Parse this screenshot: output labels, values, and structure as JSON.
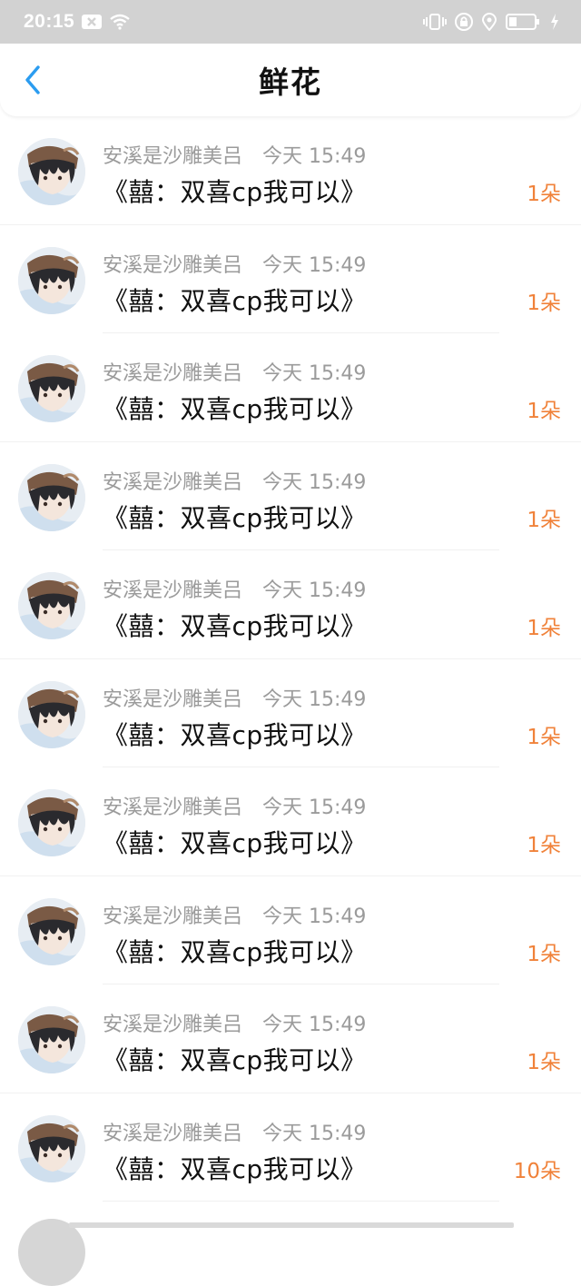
{
  "status_bar": {
    "time": "20:15",
    "icons": [
      "notification-x-icon",
      "wifi-icon",
      "vibrate-icon",
      "lock-icon",
      "location-icon",
      "battery-icon",
      "charging-icon"
    ]
  },
  "header": {
    "title": "鲜花",
    "back_icon": "chevron-left-icon"
  },
  "colors": {
    "accent_blue": "#2b9cf0",
    "count_orange": "#f0823a",
    "meta_gray": "#9b9b9b"
  },
  "rows": [
    {
      "sender": "安溪是沙雕美吕",
      "day": "今天",
      "time": "15:49",
      "message": "《囍：双喜cp我可以》",
      "count": "1朵"
    },
    {
      "sender": "安溪是沙雕美吕",
      "day": "今天",
      "time": "15:49",
      "message": "《囍：双喜cp我可以》",
      "count": "1朵"
    },
    {
      "sender": "安溪是沙雕美吕",
      "day": "今天",
      "time": "15:49",
      "message": "《囍：双喜cp我可以》",
      "count": "1朵"
    },
    {
      "sender": "安溪是沙雕美吕",
      "day": "今天",
      "time": "15:49",
      "message": "《囍：双喜cp我可以》",
      "count": "1朵"
    },
    {
      "sender": "安溪是沙雕美吕",
      "day": "今天",
      "time": "15:49",
      "message": "《囍：双喜cp我可以》",
      "count": "1朵"
    },
    {
      "sender": "安溪是沙雕美吕",
      "day": "今天",
      "time": "15:49",
      "message": "《囍：双喜cp我可以》",
      "count": "1朵"
    },
    {
      "sender": "安溪是沙雕美吕",
      "day": "今天",
      "time": "15:49",
      "message": "《囍：双喜cp我可以》",
      "count": "1朵"
    },
    {
      "sender": "安溪是沙雕美吕",
      "day": "今天",
      "time": "15:49",
      "message": "《囍：双喜cp我可以》",
      "count": "1朵"
    },
    {
      "sender": "安溪是沙雕美吕",
      "day": "今天",
      "time": "15:49",
      "message": "《囍：双喜cp我可以》",
      "count": "1朵"
    },
    {
      "sender": "安溪是沙雕美吕",
      "day": "今天",
      "time": "15:49",
      "message": "《囍：双喜cp我可以》",
      "count": "10朵"
    }
  ]
}
